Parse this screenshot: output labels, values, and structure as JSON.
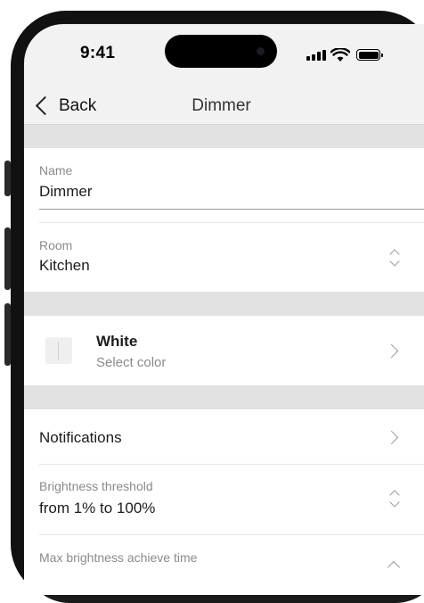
{
  "status_bar": {
    "time": "9:41"
  },
  "nav": {
    "back_label": "Back",
    "title": "Dimmer"
  },
  "name_field": {
    "label": "Name",
    "value": "Dimmer"
  },
  "room_field": {
    "label": "Room",
    "value": "Kitchen"
  },
  "color_row": {
    "title": "White",
    "subtitle": "Select color",
    "swatch_color": "#efefef"
  },
  "notifications": {
    "label": "Notifications"
  },
  "brightness_threshold": {
    "label": "Brightness threshold",
    "value": "from 1% to 100%"
  },
  "max_brightness": {
    "label": "Max brightness achieve time"
  },
  "colors": {
    "screen_bg": "#f2f2f2",
    "gap": "#e2e2e2",
    "card": "#ffffff",
    "secondary_text": "#8a8a8a"
  }
}
